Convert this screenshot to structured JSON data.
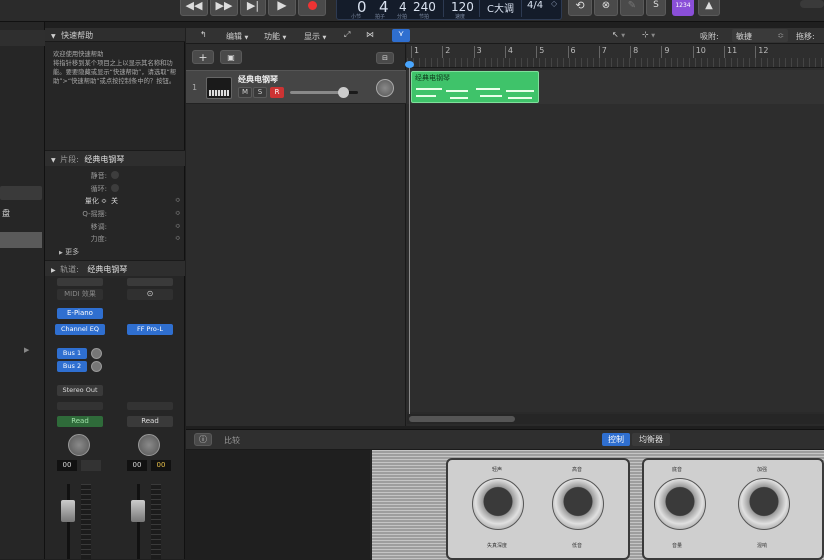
{
  "transport": {
    "lcd_bar": "0",
    "lcd_beat": "4",
    "lcd_div": "4",
    "lcd_tick": "240",
    "lcd_bar_label": "小节",
    "lcd_beat_label": "拍子",
    "lcd_div_label": "分拍",
    "lcd_tick_label": "节拍",
    "tempo": "120",
    "tempo_label": "速度",
    "key": "C大调",
    "time_sig": "4/4",
    "count_in": "1234"
  },
  "help": {
    "header": "快速帮助",
    "body": "欢迎使用快速帮助\n将指针移到某个项目之上以显示其名称和功能。要要隐藏或显示“快速帮助”，请选取“帮助”>“快速帮助”或点按控制条中的？按钮。"
  },
  "region_inspector": {
    "header_prefix": "片段:",
    "header_name": "经典电钢琴",
    "rows": [
      {
        "label": "静音:",
        "value": ""
      },
      {
        "label": "循环:",
        "value": ""
      },
      {
        "label": "量化 ≎",
        "value": "关"
      },
      {
        "label": "Q-摇摆:",
        "value": ""
      },
      {
        "label": "移调:",
        "value": ""
      },
      {
        "label": "力度:",
        "value": ""
      }
    ],
    "more": "更多"
  },
  "track_inspector": {
    "header_prefix": "轨道:",
    "header_name": "经典电钢琴"
  },
  "left_edge": {
    "label": "盘"
  },
  "channel_strips": {
    "midi_fx": "MIDI 效果",
    "instrument": "E-Piano",
    "eq": "Channel EQ",
    "plugin2": "FF Pro-L",
    "bus1": "Bus 1",
    "bus2": "Bus 2",
    "output": "Stereo Out",
    "auto1": "Read",
    "auto2": "Read",
    "vol1": "00",
    "vol2": "00",
    "vol3": "00"
  },
  "tracks_toolbar": {
    "edit": "编辑",
    "function": "功能",
    "view": "显示",
    "snap_label": "吸附:",
    "snap_value": "敏捷",
    "drag_label": "拖移:"
  },
  "track": {
    "number": "1",
    "name": "经典电钢琴",
    "mute": "M",
    "solo": "S",
    "record": "R",
    "volume": 0.78
  },
  "ruler": [
    "1",
    "2",
    "3",
    "4",
    "5",
    "6",
    "7",
    "8",
    "9",
    "10",
    "11",
    "12"
  ],
  "region": {
    "name": "经典电钢琴"
  },
  "editor": {
    "compare": "比较",
    "tab_controls": "控制",
    "tab_eq": "均衡器"
  },
  "plugin": {
    "knob_labels": [
      "轻声",
      "高音",
      "底音",
      "加强"
    ],
    "knob_labels_bottom": [
      "失真深度",
      "低音",
      "音量",
      "混响"
    ]
  },
  "colors": {
    "accent_blue": "#3a87ff",
    "region_green": "#3fc36a",
    "record_red": "#d33",
    "count_in_purple": "#8a4fd8"
  }
}
